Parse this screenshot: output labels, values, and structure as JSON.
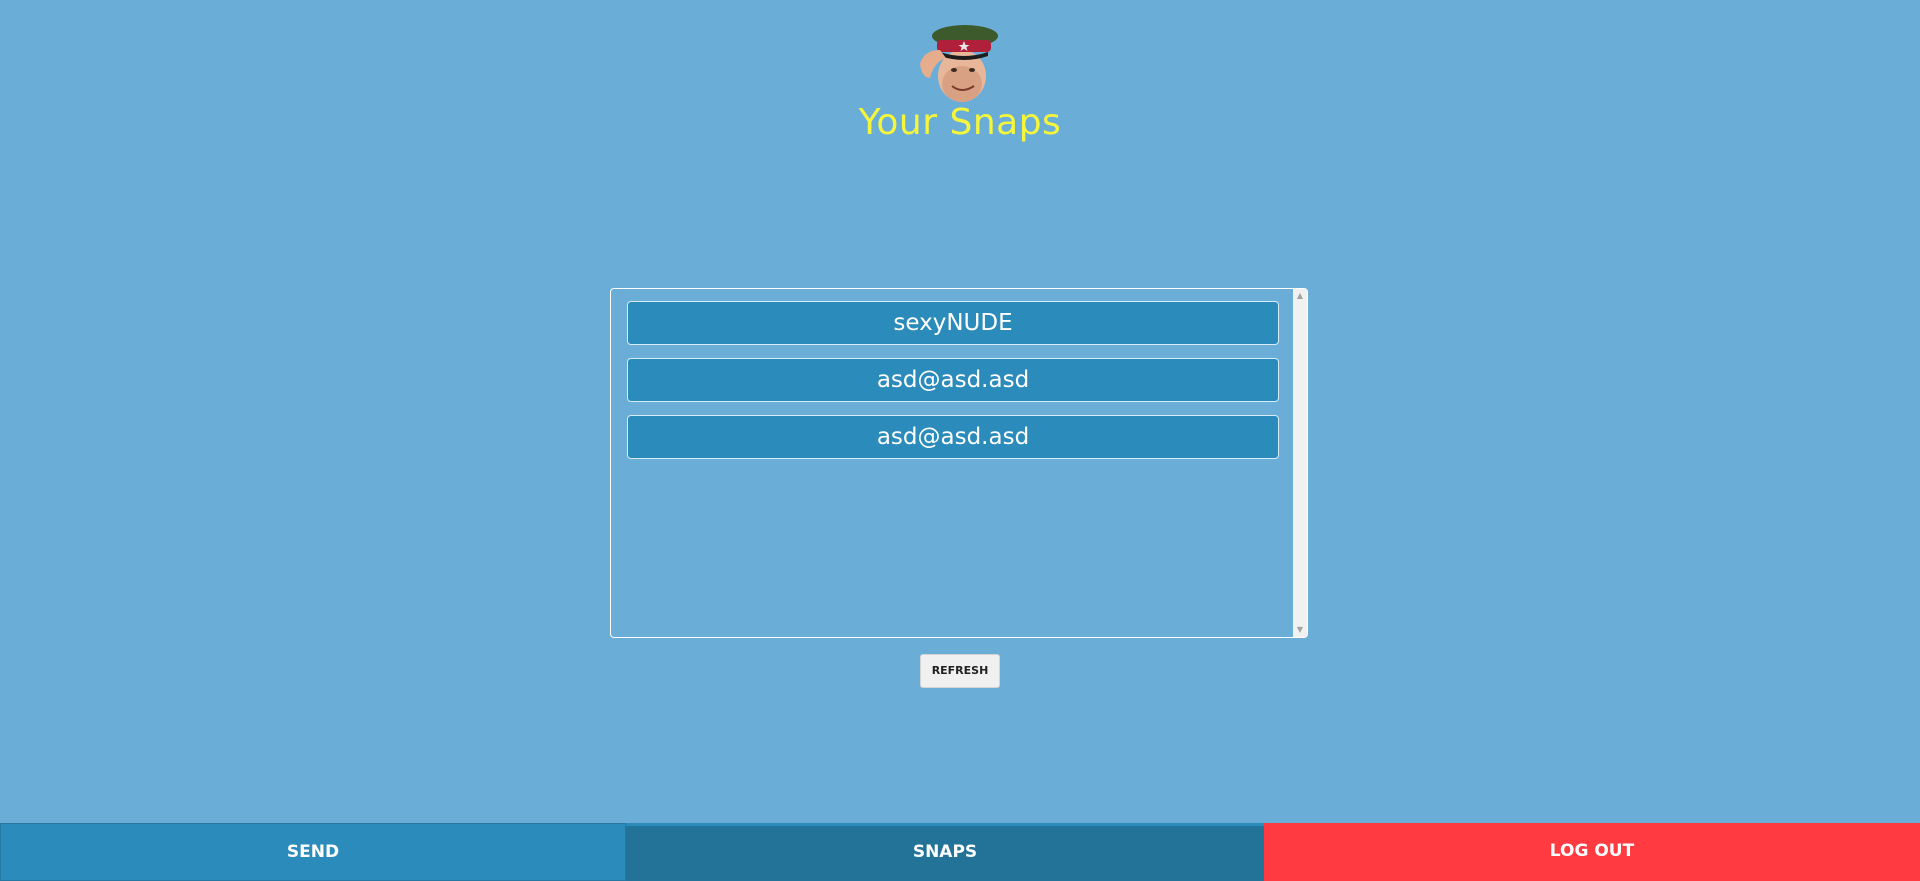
{
  "header": {
    "title": "Your Snaps",
    "avatar_icon": "saluting-soldier-avatar-icon"
  },
  "snaps": {
    "items": [
      {
        "label": "sexyNUDE"
      },
      {
        "label": "asd@asd.asd"
      },
      {
        "label": "asd@asd.asd"
      }
    ]
  },
  "actions": {
    "refresh_label": "REFRESH"
  },
  "nav": {
    "send_label": "SEND",
    "snaps_label": "SNAPS",
    "logout_label": "LOG OUT"
  },
  "colors": {
    "background": "#6aaed8",
    "title": "#f5f53c",
    "item": "#2b8bba",
    "active_tab": "#237399",
    "logout": "#ff3a40"
  }
}
